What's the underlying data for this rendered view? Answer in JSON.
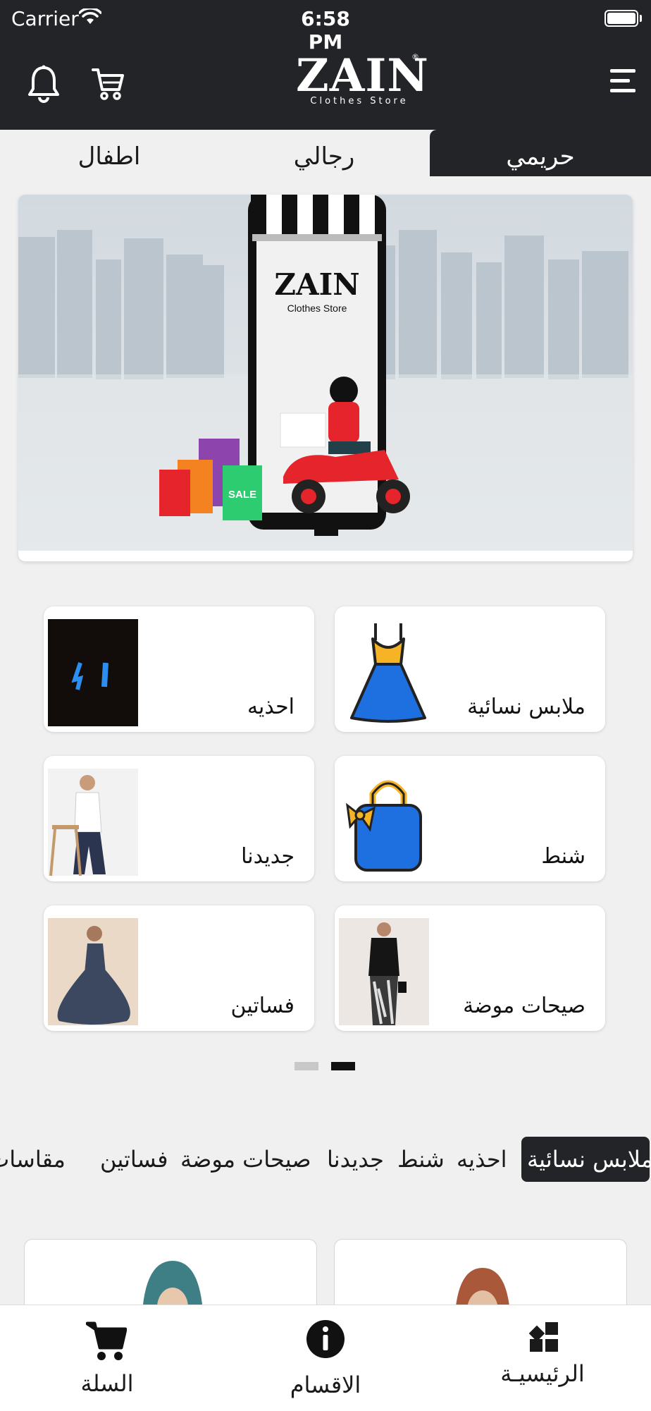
{
  "status": {
    "carrier": "Carrier",
    "time": "6:58 PM"
  },
  "header": {
    "logo_title": "ZAIN",
    "logo_subtitle": "Clothes Store",
    "logo_reg": "®"
  },
  "tabs": [
    {
      "label": "حريمي",
      "active": true
    },
    {
      "label": "رجالي",
      "active": false
    },
    {
      "label": "اطفال",
      "active": false
    }
  ],
  "banner": {
    "title": "ZAIN",
    "subtitle": "Clothes Store",
    "bag_tag": "SALE"
  },
  "categories": [
    {
      "label": "ملابس نسائية",
      "icon": "dress-icon"
    },
    {
      "label": "احذيه",
      "icon": "shoes-photo"
    },
    {
      "label": "شنط",
      "icon": "handbag-icon"
    },
    {
      "label": "جديدنا",
      "icon": "new-arrivals-photo"
    },
    {
      "label": "صيحات موضة",
      "icon": "fashion-trends-photo"
    },
    {
      "label": "فساتين",
      "icon": "dresses-photo"
    }
  ],
  "pager": {
    "pages": 2,
    "active_page": 1
  },
  "chips": [
    "ملابس نسائية",
    "احذيه",
    "شنط",
    "جديدنا",
    "صيحات موضة",
    "فساتين",
    "مقاسات كبيرة"
  ],
  "bottom_nav": {
    "home": "الرئيسيـة",
    "categories": "الاقسام",
    "cart": "السلة"
  },
  "colors": {
    "dark": "#232427",
    "background": "#f0f0f1",
    "accent_blue": "#1e6fe0",
    "accent_yellow": "#f5b325"
  }
}
